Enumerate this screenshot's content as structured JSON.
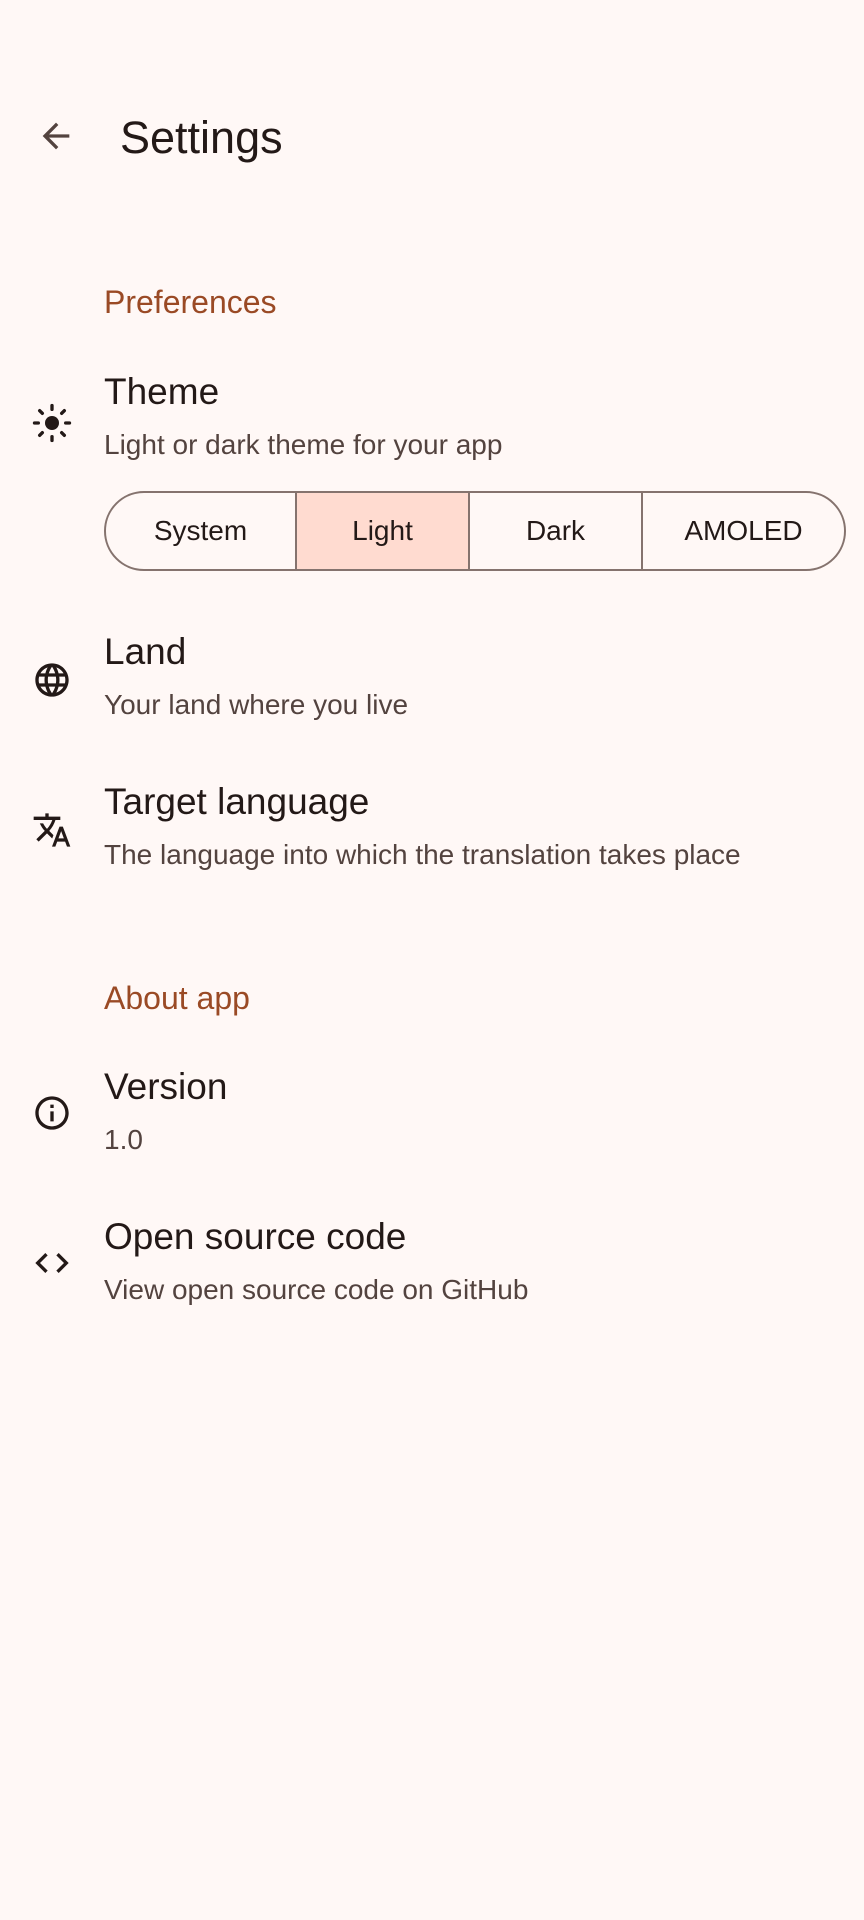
{
  "app_bar": {
    "back_icon": "arrow-back-icon",
    "title": "Settings"
  },
  "sections": {
    "preferences": {
      "header": "Preferences",
      "theme": {
        "icon": "sun-icon",
        "title": "Theme",
        "subtitle": "Light or dark theme for your app",
        "options": [
          "System",
          "Light",
          "Dark",
          "AMOLED"
        ],
        "selected": "Light"
      },
      "land": {
        "icon": "globe-icon",
        "title": "Land",
        "subtitle": "Your land where you live"
      },
      "target_language": {
        "icon": "translate-icon",
        "title": "Target language",
        "subtitle": "The language into which the translation takes place"
      }
    },
    "about": {
      "header": "About app",
      "version": {
        "icon": "info-icon",
        "title": "Version",
        "subtitle": "1.0"
      },
      "source": {
        "icon": "code-icon",
        "title": "Open source code",
        "subtitle": "View open source code on GitHub"
      }
    }
  },
  "colors": {
    "background": "#fff8f6",
    "accent": "#9a4a25",
    "selected_segment": "#ffdbd0",
    "outline": "#85736e"
  }
}
